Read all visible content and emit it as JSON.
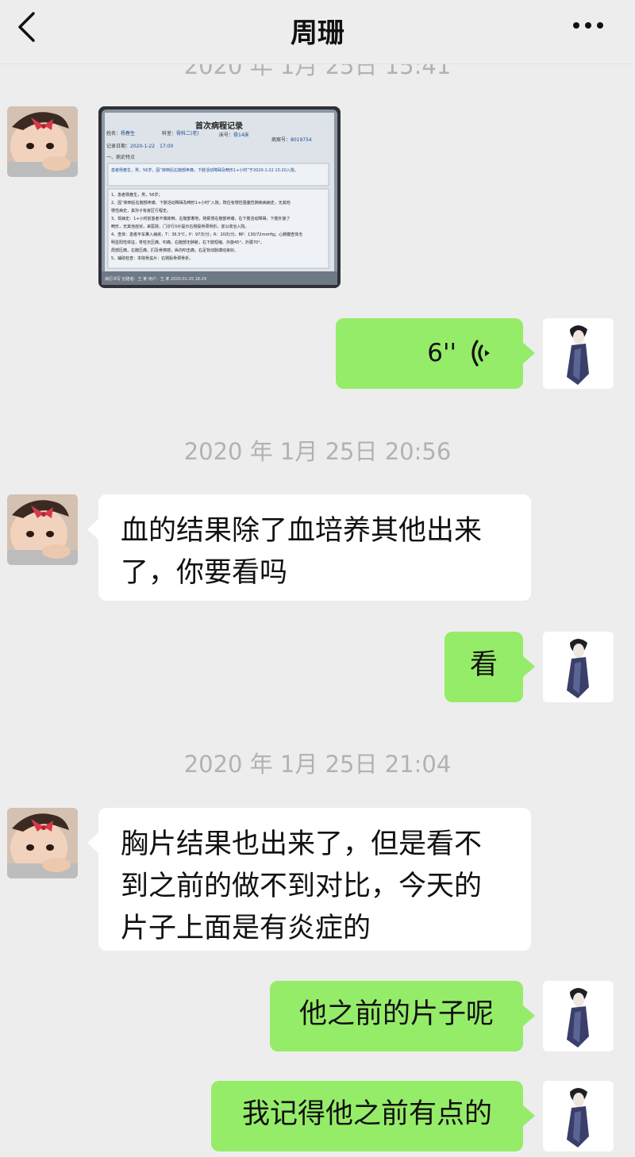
{
  "header": {
    "title": "周珊"
  },
  "messages": [
    {
      "id": "m0",
      "kind": "timestamp",
      "text": "2020 年 1月 25日 15:41"
    },
    {
      "id": "m1",
      "kind": "image",
      "from": "contact",
      "document": {
        "title": "首次病程记录",
        "fields": {
          "name_label": "姓名：",
          "dept_label": "科室：",
          "bed_label": "床号：",
          "case_label": "病案号：",
          "record_date_label": "记录日期："
        },
        "values": {
          "name": "杨春生",
          "dept": "骨科二(老)",
          "bed": "骨14床",
          "case_no": "8019754",
          "date": "2020-1-22",
          "time": "17:00"
        },
        "section": "一、病史特点",
        "summary": "患者杨春生，男，56岁，因“摔倒后右髋部疼痛，下肢活动障碍及畸形1+小时”于2020-1-22 15:20入院。",
        "lines": [
          "1、患者杨春生，男，56岁；",
          "2、因“摔倒后右髋部疼痛、下肢活动障碍及畸形1+小时”入院，既往有慢性阻塞性肺疾病病史，无其他",
          "慢性病史，其孙子有疫区行程史。",
          "3、现病史：1+小时前患者不慎摔倒，右髋部着地，随即感右髋部疼痛，右下肢活动障碍，下肢外旋了",
          "畸形，无其他症状，来医院，门诊行X片提示右侧股骨颈骨折，遂以收治入院。",
          "4、查体：患者平车推入病房，T：36.5℃，P：97次/分，R：20次/分，BP：130/72mmHg；心肺腹查体无",
          "明显阳性体征，脊柱无压痛、叩痛，右髋部无肿胀，右下肢短缩、外旋45°，外展70°，",
          "局部压痛，右髋压痛，扪及骨擦感，纵向叩击痛，右足背动脉搏动良好。",
          "5、辅助检查：本院骨盆片：右侧股骨颈骨折。"
        ],
        "footer": "病历书写  创建者：王 某  用户：王 某  2020-01-25 18:29"
      }
    },
    {
      "id": "m2",
      "kind": "voice",
      "from": "me",
      "duration": "6''"
    },
    {
      "id": "m3",
      "kind": "timestamp",
      "text": "2020 年 1月 25日 20:56"
    },
    {
      "id": "m4",
      "kind": "text",
      "from": "contact",
      "lines": [
        "血的结果除了血培养其他出来",
        "了，你要看吗"
      ]
    },
    {
      "id": "m5",
      "kind": "text",
      "from": "me",
      "lines": [
        "看"
      ]
    },
    {
      "id": "m6",
      "kind": "timestamp",
      "text": "2020 年 1月 25日 21:04"
    },
    {
      "id": "m7",
      "kind": "text",
      "from": "contact",
      "lines": [
        "胸片结果也出来了，但是看不",
        "到之前的做不到对比，今天的",
        "片子上面是有炎症的"
      ]
    },
    {
      "id": "m8",
      "kind": "text",
      "from": "me",
      "lines": [
        "他之前的片子呢"
      ]
    },
    {
      "id": "m9",
      "kind": "text",
      "from": "me",
      "lines": [
        "我记得他之前有点的"
      ]
    }
  ],
  "colors": {
    "background": "#ededed",
    "outgoing_bubble": "#95ec69",
    "incoming_bubble": "#ffffff",
    "timestamp": "#b2b2b2"
  },
  "icons": [
    "back-chevron-icon",
    "more-dots-icon",
    "voice-wave-icon"
  ]
}
